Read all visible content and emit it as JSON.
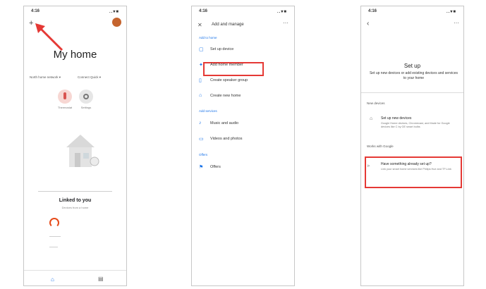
{
  "screens": [
    {
      "status": {
        "time": "4:16",
        "signal": "..▾■"
      },
      "title": "My home",
      "icons": {
        "add": "plus-icon",
        "account": "avatar",
        "arrow": "red-arrow-annotation"
      },
      "dropdowns": [
        "North home network",
        "Connect Quick"
      ],
      "shortcuts": [
        "Thermostat",
        "Settings"
      ],
      "linked_title": "Linked to you",
      "linked_subtitle": "Devices from a home",
      "nav": {
        "home_icon": "home-icon",
        "rooms_icon": "rooms-icon"
      }
    },
    {
      "status": {
        "time": "4:16",
        "signal": "..▾■"
      },
      "title": "Add and manage",
      "sections": [
        {
          "label": "Add to home",
          "items": [
            {
              "icon": "device-icon",
              "glyph": "▢",
              "label": "Set up device"
            },
            {
              "icon": "members-icon",
              "glyph": "✦",
              "label": "Add home member"
            },
            {
              "icon": "speaker-icon",
              "glyph": "▯",
              "label": "Create speaker group"
            },
            {
              "icon": "home-icon",
              "glyph": "⌂",
              "label": "Create new home"
            }
          ]
        },
        {
          "label": "Add services",
          "items": [
            {
              "icon": "music-icon",
              "glyph": "♪",
              "label": "Music and audio"
            },
            {
              "icon": "video-icon",
              "glyph": "▭",
              "label": "Videos and photos"
            }
          ]
        },
        {
          "label": "Offers",
          "items": [
            {
              "icon": "offers-icon",
              "glyph": "⚑",
              "label": "Offers"
            }
          ]
        }
      ]
    },
    {
      "status": {
        "time": "4:16",
        "signal": "..▾■"
      },
      "title": "Set up",
      "subtitle": "Set up new devices or add existing devices and services to your home",
      "new_devices_header": "New devices",
      "new_device": {
        "title": "Set up new devices",
        "desc": "Google Home devices, Chromecast, and Made for Google devices like C by GE smart bulbs"
      },
      "works_with_header": "Works with Google",
      "existing": {
        "title": "Have something already set up?",
        "desc": "Link your smart home services like Philips Hue and TP-Link"
      }
    }
  ],
  "colors": {
    "highlight": "#e53935",
    "accent": "#1a73e8",
    "avatar": "#c5642e"
  }
}
